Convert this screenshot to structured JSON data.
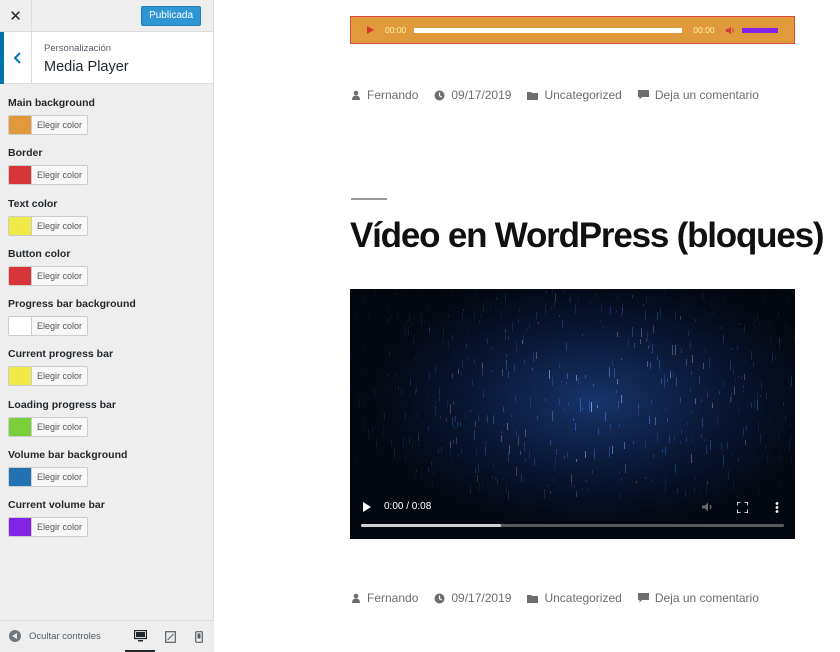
{
  "topbar": {
    "close_label": "✕",
    "publish_label": "Publicada"
  },
  "section": {
    "breadcrumb": "Personalización",
    "title": "Media Player"
  },
  "controls": [
    {
      "label": "Main background",
      "color": "#e0993b",
      "button": "Elegir color"
    },
    {
      "label": "Border",
      "color": "#d63638",
      "button": "Elegir color"
    },
    {
      "label": "Text color",
      "color": "#eee944",
      "button": "Elegir color"
    },
    {
      "label": "Button color",
      "color": "#d63638",
      "button": "Elegir color"
    },
    {
      "label": "Progress bar background",
      "color": "#ffffff",
      "button": "Elegir color"
    },
    {
      "label": "Current progress bar",
      "color": "#eee944",
      "button": "Elegir color"
    },
    {
      "label": "Loading progress bar",
      "color": "#7ad03a",
      "button": "Elegir color"
    },
    {
      "label": "Volume bar background",
      "color": "#2271b1",
      "button": "Elegir color"
    },
    {
      "label": "Current volume bar",
      "color": "#8224e3",
      "button": "Elegir color"
    }
  ],
  "footer": {
    "hide_controls": "Ocultar controles"
  },
  "audio_player": {
    "current_time": "00:00",
    "duration": "00:00",
    "progress": 0,
    "volume": 1.0
  },
  "post_meta": {
    "author": "Fernando",
    "date": "09/17/2019",
    "category": "Uncategorized",
    "comments": "Deja un comentario"
  },
  "post": {
    "title": "Vídeo en WordPress (bloques)"
  },
  "video_player": {
    "time": "0:00 / 0:08",
    "progress": 0.33
  },
  "icons": {
    "close": "close-icon",
    "back": "chevron-left-icon",
    "hide": "collapse-arrow-icon",
    "desktop": "desktop-icon",
    "tablet": "tablet-icon",
    "mobile": "mobile-icon",
    "author": "user-icon",
    "date": "clock-icon",
    "category": "folder-icon",
    "comments": "comment-icon",
    "play": "play-icon",
    "volume": "volume-icon",
    "fullscreen": "fullscreen-icon",
    "more": "more-vertical-icon"
  },
  "colors": {
    "accent": "#0073aa",
    "publish": "#2e96d3"
  }
}
